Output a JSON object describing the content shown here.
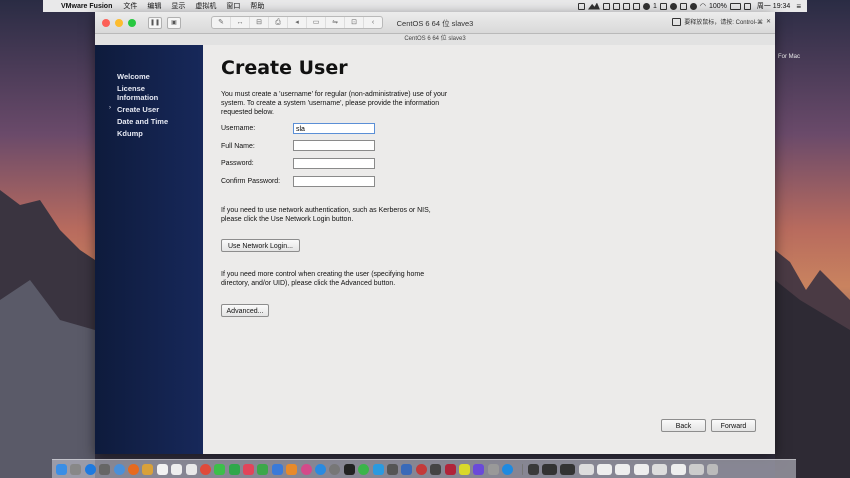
{
  "menubar": {
    "app": "VMware Fusion",
    "items": [
      "文件",
      "编辑",
      "显示",
      "虚拟机",
      "窗口",
      "帮助"
    ],
    "battery": "100%",
    "clock": "周一 19:34",
    "badge": "1"
  },
  "window": {
    "title": "CentOS 6 64 位 slave3",
    "subtitle": "CentOS 6 64 位 slave3",
    "hint": "要释放鼠标，请按: Control-⌘"
  },
  "desktop_label": "For Mac",
  "sidebar": {
    "items": [
      {
        "label": "Welcome"
      },
      {
        "label": "License"
      },
      {
        "label": "Information"
      },
      {
        "label": "Create User"
      },
      {
        "label": "Date and Time"
      },
      {
        "label": "Kdump"
      }
    ],
    "current_marker": "›"
  },
  "page": {
    "title": "Create User",
    "intro_lines": [
      "You must create a 'username' for regular (non-administrative) use of your",
      "system.  To create a system 'username', please provide the information",
      "requested below."
    ],
    "fields": {
      "username_label": "Username:",
      "username_value": "sla",
      "fullname_label": "Full Name:",
      "password_label": "Password:",
      "confirm_label": "Confirm Password:"
    },
    "network_lines": [
      "If you need to use network authentication, such as Kerberos or NIS,",
      "please click the Use Network Login button."
    ],
    "network_button": "Use Network Login...",
    "advanced_lines": [
      "If you need more control when creating the user (specifying home",
      "directory, and/or UID), please click the Advanced button."
    ],
    "advanced_button": "Advanced...",
    "back_button": "Back",
    "forward_button": "Forward"
  }
}
